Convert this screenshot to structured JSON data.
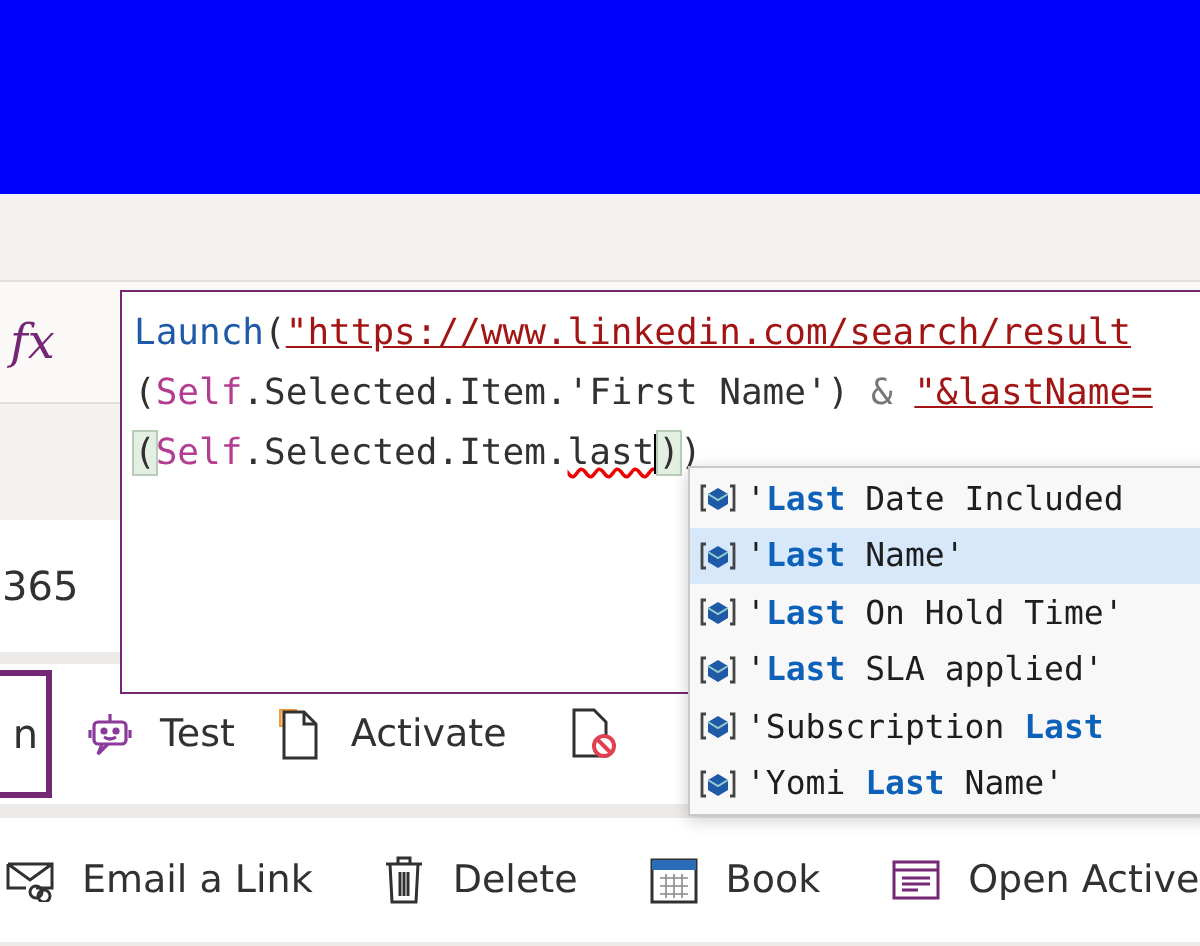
{
  "formula_bar": {
    "fx_label": "fx",
    "code_lines": [
      [
        {
          "kind": "function",
          "text": "Launch"
        },
        {
          "kind": "plain",
          "text": "("
        },
        {
          "kind": "string",
          "text": "\"https://www.linkedin.com/search/result"
        }
      ],
      [
        {
          "kind": "plain",
          "text": "("
        },
        {
          "kind": "keyword",
          "text": "Self"
        },
        {
          "kind": "plain",
          "text": ".Selected.Item.'First Name') "
        },
        {
          "kind": "operator",
          "text": "& "
        },
        {
          "kind": "string",
          "text": "\"&lastName="
        }
      ],
      [
        {
          "kind": "paren",
          "text": "("
        },
        {
          "kind": "keyword",
          "text": "Self"
        },
        {
          "kind": "plain",
          "text": ".Selected.Item."
        },
        {
          "kind": "error",
          "text": "last"
        },
        {
          "kind": "cursor"
        },
        {
          "kind": "paren",
          "text": ")"
        },
        {
          "kind": "plain",
          "text": ")"
        }
      ]
    ]
  },
  "field_row": {
    "value": "365"
  },
  "suggestions": [
    {
      "selected": false,
      "parts": [
        {
          "kind": "plain",
          "text": "'"
        },
        {
          "kind": "match",
          "text": "Last"
        },
        {
          "kind": "plain",
          "text": " Date Included"
        }
      ]
    },
    {
      "selected": true,
      "parts": [
        {
          "kind": "plain",
          "text": "'"
        },
        {
          "kind": "match",
          "text": "Last"
        },
        {
          "kind": "plain",
          "text": " Name'"
        }
      ]
    },
    {
      "selected": false,
      "parts": [
        {
          "kind": "plain",
          "text": "'"
        },
        {
          "kind": "match",
          "text": "Last"
        },
        {
          "kind": "plain",
          "text": " On Hold Time'"
        }
      ]
    },
    {
      "selected": false,
      "parts": [
        {
          "kind": "plain",
          "text": "'"
        },
        {
          "kind": "match",
          "text": "Last"
        },
        {
          "kind": "plain",
          "text": " SLA applied'"
        }
      ]
    },
    {
      "selected": false,
      "parts": [
        {
          "kind": "plain",
          "text": "'Subscription "
        },
        {
          "kind": "match",
          "text": "Last"
        }
      ]
    },
    {
      "selected": false,
      "parts": [
        {
          "kind": "plain",
          "text": "'Yomi "
        },
        {
          "kind": "match",
          "text": "Last"
        },
        {
          "kind": "plain",
          "text": " Name'"
        }
      ]
    }
  ],
  "toolbar": [
    {
      "kind": "cut",
      "label": "n"
    },
    {
      "kind": "bot",
      "label": "Test"
    },
    {
      "kind": "activate",
      "label": "Activate"
    },
    {
      "kind": "blocked"
    }
  ],
  "command_bar": [
    {
      "kind": "email",
      "label": "Email a Link"
    },
    {
      "kind": "delete",
      "label": "Delete"
    },
    {
      "kind": "calendar",
      "label": "Book"
    },
    {
      "kind": "form",
      "label": "Open Active"
    }
  ]
}
